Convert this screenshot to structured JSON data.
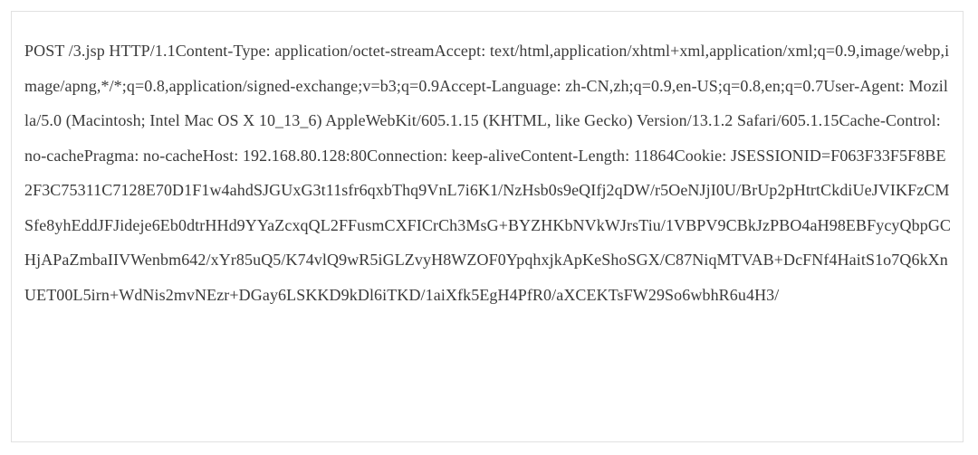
{
  "http_request": {
    "raw": "POST /3.jsp HTTP/1.1Content-Type: application/octet-streamAccept: text/html,application/xhtml+xml,application/xml;q=0.9,image/webp,image/apng,*/*;q=0.8,application/signed-exchange;v=b3;q=0.9Accept-Language: zh-CN,zh;q=0.9,en-US;q=0.8,en;q=0.7User-Agent: Mozilla/5.0 (Macintosh; Intel Mac OS X 10_13_6) AppleWebKit/605.1.15 (KHTML, like Gecko) Version/13.1.2 Safari/605.1.15Cache-Control: no-cachePragma: no-cacheHost: 192.168.80.128:80Connection: keep-aliveContent-Length: 11864Cookie: JSESSIONID=F063F33F5F8BE2F3C75311C7128E70D1F1w4ahdSJGUxG3t11sfr6qxbThq9VnL7i6K1/NzHsb0s9eQIfj2qDW/r5OeNJjI0U/BrUp2pHtrtCkdiUeJVIKFzCMSfe8yhEddJFJideje6Eb0dtrHHd9YYaZcxqQL2FFusmCXFICrCh3MsG+BYZHKbNVkWJrsTiu/1VBPV9CBkJzPBO4aH98EBFycyQbpGCHjAPaZmbaIIVWenbm642/xYr85uQ5/K74vlQ9wR5iGLZvyH8WZOF0YpqhxjkApKeShoSGX/C87NiqMTVAB+DcFNf4HaitS1o7Q6kXnUET00L5irn+WdNis2mvNEzr+DGay6LSKKD9kDl6iTKD/1aiXfk5EgH4PfR0/aXCEKTsFW29So6wbhR6u4H3/"
  }
}
